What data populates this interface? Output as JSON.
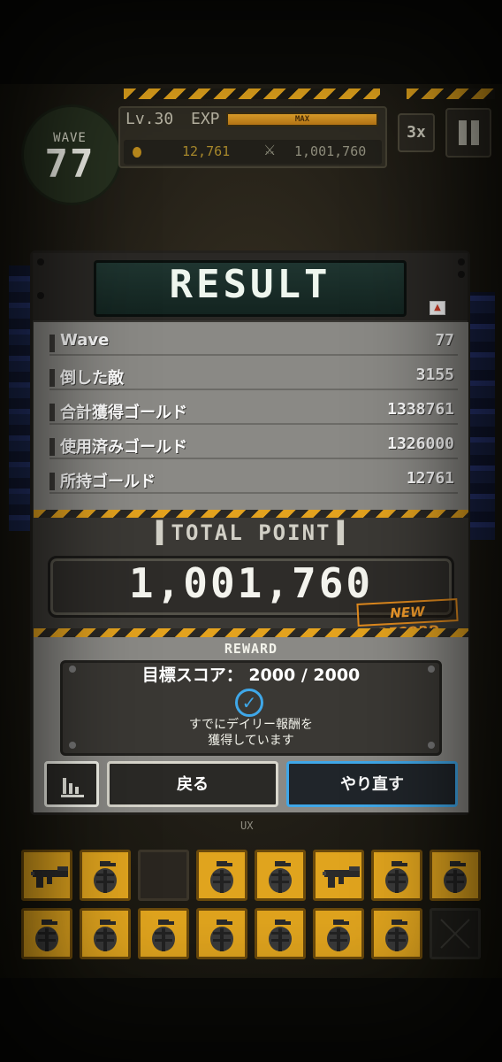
{
  "hud": {
    "wave_label": "WAVE",
    "wave_number": "77",
    "level": "Lv.30",
    "exp_label": "EXP",
    "exp_max_label": "MAX",
    "exp_fill": 1.0,
    "gold": "12,761",
    "point": "1,001,760",
    "speed": "3x"
  },
  "result": {
    "title": "RESULT",
    "stats": [
      {
        "label": "Wave",
        "value": "77"
      },
      {
        "label": "倒した敵",
        "value": "3155"
      },
      {
        "label": "合計獲得ゴールド",
        "value": "1338761"
      },
      {
        "label": "使用済みゴールド",
        "value": "1326000"
      },
      {
        "label": "所持ゴールド",
        "value": "12761"
      }
    ],
    "total_label": "▌TOTAL POINT▐",
    "total_value": "1,001,760",
    "new_record": "NEW RECORD",
    "reward_label": "REWARD",
    "target_score": "目標スコア： 2000 / 2000",
    "reward_msg_1": "すでにデイリー報酬を",
    "reward_msg_2": "獲得しています",
    "back_label": "戻る",
    "retry_label": "やり直す"
  },
  "inventory": {
    "label": "UX",
    "slots": [
      "rifle",
      "grenade",
      "empty-dark",
      "grenade",
      "grenade",
      "rifle",
      "grenade",
      "grenade",
      "grenade",
      "grenade",
      "grenade",
      "grenade",
      "grenade",
      "grenade",
      "grenade",
      "empty"
    ]
  },
  "colors": {
    "accent_orange": "#e3a21e",
    "accent_blue": "#3fa7e8"
  }
}
